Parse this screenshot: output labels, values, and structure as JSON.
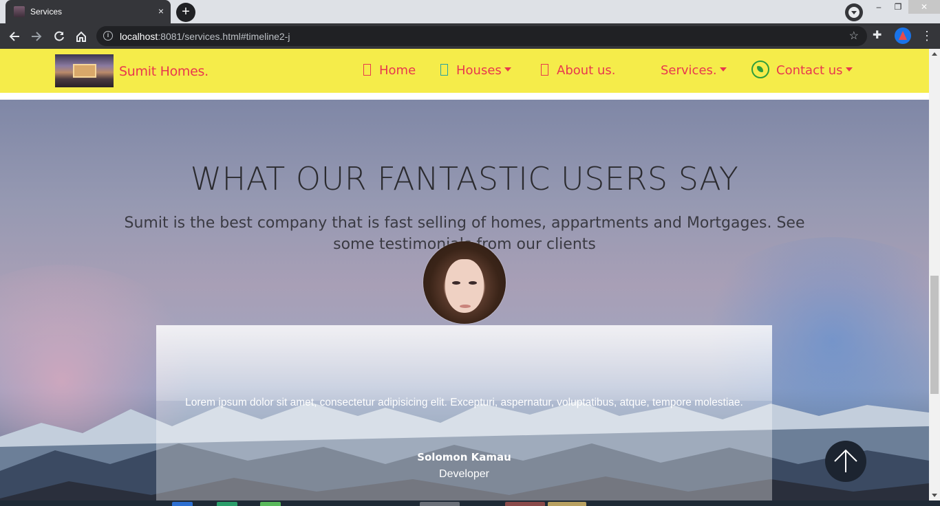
{
  "browser": {
    "tab_title": "Services",
    "tab_close": "×",
    "new_tab": "+",
    "url_host": "localhost",
    "url_rest": ":8081/services.html#timeline2-j",
    "window_controls": {
      "minimize": "–",
      "restore": "❐",
      "close": "✕"
    }
  },
  "navbar": {
    "brand": "Sumit Homes.",
    "items": [
      {
        "label": "Home",
        "dropdown": false
      },
      {
        "label": "Houses",
        "dropdown": true
      },
      {
        "label": "About us.",
        "dropdown": false
      },
      {
        "label": "Services.",
        "dropdown": true
      },
      {
        "label": "Contact us",
        "dropdown": true
      }
    ],
    "colors": {
      "background": "#f5ec4a",
      "text": "#e8374e",
      "whatsapp": "#2e9d3c"
    }
  },
  "testimonials": {
    "title": "WHAT OUR FANTASTIC USERS SAY",
    "subtitle": "Sumit is the best company that is fast selling of homes, appartments and Mortgages. See some testimonials from our clients",
    "card": {
      "quote": "Lorem ipsum dolor sit amet, consectetur adipisicing elit. Excepturi, aspernatur, voluptatibus, atque, tempore molestiae.",
      "name": "Solomon Kamau",
      "role": "Developer"
    }
  },
  "icons": {
    "back": "arrow-left-icon",
    "forward": "arrow-right-icon",
    "reload": "reload-icon",
    "home": "home-icon",
    "back_to_top": "arrow-up-icon"
  }
}
